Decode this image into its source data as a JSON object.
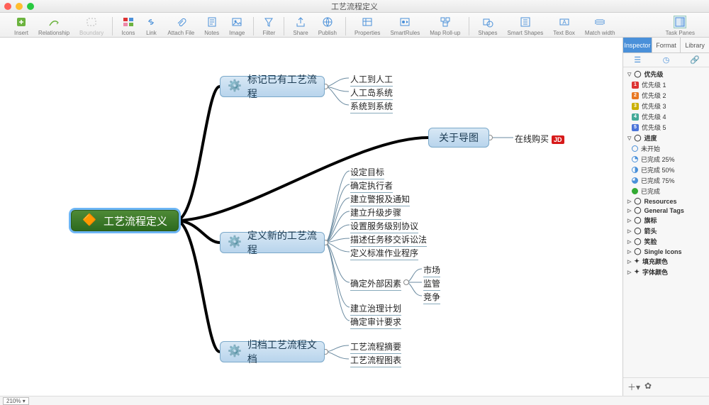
{
  "window": {
    "title": "工艺流程定义"
  },
  "toolbar": {
    "insert": "Insert",
    "relationship": "Relationship",
    "boundary": "Boundary",
    "icons": "Icons",
    "link": "Link",
    "attachfile": "Attach File",
    "notes": "Notes",
    "image": "Image",
    "filter": "Filter",
    "share": "Share",
    "publish": "Publish",
    "properties": "Properties",
    "smartrules": "SmartRules",
    "maprollup": "Map Roll-up",
    "shapes": "Shapes",
    "smartshapes": "Smart Shapes",
    "textbox": "Text Box",
    "matchwidth": "Match width",
    "taskpanes": "Task Panes"
  },
  "mindmap": {
    "central": "工艺流程定义",
    "branch1": {
      "label": "标记已有工艺流程",
      "leaves": [
        "人工到人工",
        "人工岛系统",
        "系统到系统"
      ]
    },
    "branch2": {
      "label": "关于导图",
      "leaves": [
        "在线购买"
      ]
    },
    "branch3": {
      "label": "定义新的工艺流程",
      "leaves": [
        "设定目标",
        "确定执行者",
        "建立警报及通知",
        "建立升级步骤",
        "设置服务级别协议",
        "描述任务移交诉讼法",
        "定义标准作业程序",
        "确定外部因素",
        "建立治理计划",
        "确定审计要求"
      ],
      "sub": {
        "parent": "确定外部因素",
        "items": [
          "市场",
          "监管",
          "竞争"
        ]
      }
    },
    "branch4": {
      "label": "归档工艺流程文档",
      "leaves": [
        "工艺流程摘要",
        "工艺流程图表"
      ]
    }
  },
  "sidebar": {
    "tabs": [
      "Inspector",
      "Format",
      "Library"
    ],
    "priority_hdr": "优先级",
    "priorities": [
      "优先级 1",
      "优先级 2",
      "优先级 3",
      "优先级 4",
      "优先级 5"
    ],
    "progress_hdr": "进度",
    "progress": [
      "未开始",
      "已完成 25%",
      "已完成 50%",
      "已完成 75%",
      "已完成"
    ],
    "groups": [
      "Resources",
      "General Tags",
      "旗标",
      "箭头",
      "笑脸",
      "Single Icons",
      "填充颜色",
      "字体颜色"
    ]
  },
  "status": {
    "zoom": "210%"
  },
  "chart_data": {
    "type": "mindmap",
    "title": "工艺流程定义",
    "root": "工艺流程定义",
    "children": [
      {
        "name": "标记已有工艺流程",
        "children": [
          "人工到人工",
          "人工岛系统",
          "系统到系统"
        ]
      },
      {
        "name": "关于导图",
        "children": [
          "在线购买"
        ]
      },
      {
        "name": "定义新的工艺流程",
        "children": [
          "设定目标",
          "确定执行者",
          "建立警报及通知",
          "建立升级步骤",
          "设置服务级别协议",
          "描述任务移交诉讼法",
          "定义标准作业程序",
          {
            "name": "确定外部因素",
            "children": [
              "市场",
              "监管",
              "竞争"
            ]
          },
          "建立治理计划",
          "确定审计要求"
        ]
      },
      {
        "name": "归档工艺流程文档",
        "children": [
          "工艺流程摘要",
          "工艺流程图表"
        ]
      }
    ]
  }
}
